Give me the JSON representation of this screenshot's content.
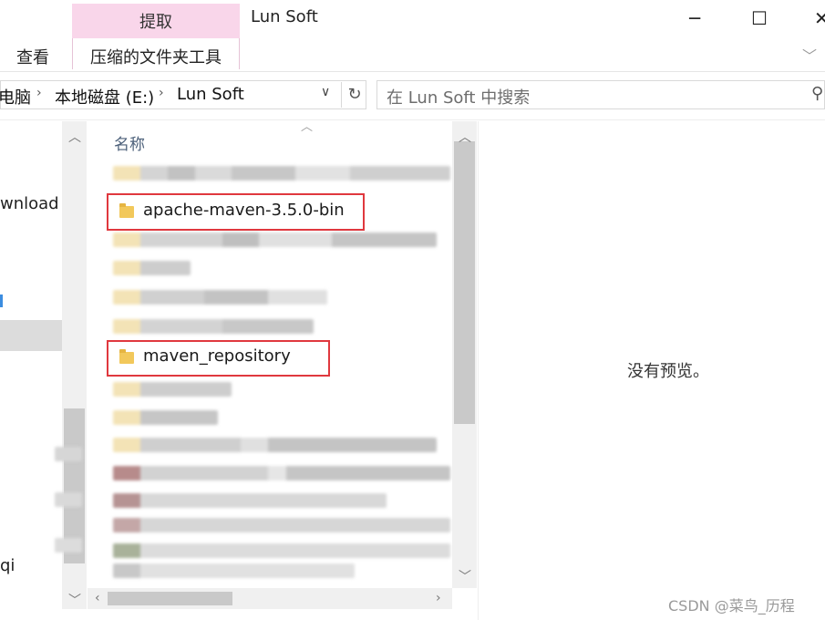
{
  "ribbon": {
    "context_group_label": "提取",
    "window_title": "Lun Soft",
    "tabs": [
      {
        "label": "查看"
      },
      {
        "label": "压缩的文件夹工具"
      }
    ],
    "window_controls": {
      "minimize": "─",
      "maximize": "☐",
      "close": "✕"
    },
    "collapse_icon": "chevron-down-icon"
  },
  "address": {
    "crumbs": [
      "电脑",
      "本地磁盘 (E:)",
      "Lun Soft"
    ],
    "separator": "›"
  },
  "search": {
    "placeholder": "在 Lun Soft 中搜索"
  },
  "nav": {
    "items": [
      "wnload",
      "qi"
    ]
  },
  "list": {
    "column_name": "名称",
    "files": [
      {
        "name": "apache-maven-3.5.0-bin",
        "highlighted": true
      },
      {
        "name": "maven_repository",
        "highlighted": true
      }
    ]
  },
  "preview": {
    "empty_text": "没有预览。"
  },
  "watermark": "CSDN @菜鸟_历程",
  "colors": {
    "context_tab": "#f9d6ea",
    "highlight_box": "#e0383e",
    "folder": "#f2c85b"
  }
}
